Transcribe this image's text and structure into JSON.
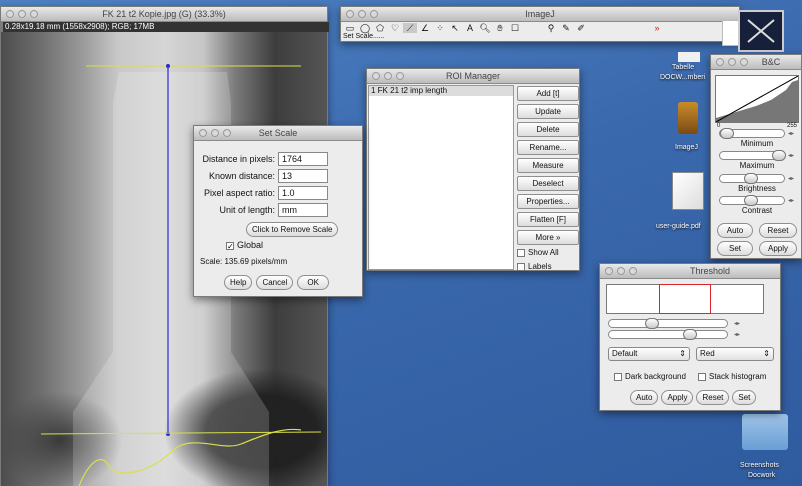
{
  "image_window": {
    "title": "FK 21 t2 Kopie.jpg (G) (33.3%)",
    "info": "0.28x19.18 mm (1558x2908); RGB; 17MB"
  },
  "imagej": {
    "title": "ImageJ",
    "status": "Set Scale......",
    "toolbar_icons": [
      "rectangle-tool",
      "oval-tool",
      "polygon-tool",
      "freehand-tool",
      "line-tool",
      "angle-tool",
      "point-tool",
      "wand-tool",
      "text-tool",
      "magnifier-tool",
      "hand-tool",
      "color-picker-tool",
      "dropper-tool",
      "pencil-tool",
      "brush-tool",
      "more-tools"
    ]
  },
  "roi_manager": {
    "title": "ROI Manager",
    "items": [
      "1 FK 21 t2 imp length"
    ],
    "buttons": [
      "Add [t]",
      "Update",
      "Delete",
      "Rename...",
      "Measure",
      "Deselect",
      "Properties...",
      "Flatten [F]",
      "More »"
    ],
    "show_all": "Show All",
    "labels": "Labels"
  },
  "set_scale": {
    "title": "Set Scale",
    "distance_label": "Distance in pixels:",
    "distance_value": "1764",
    "known_label": "Known distance:",
    "known_value": "13",
    "aspect_label": "Pixel aspect ratio:",
    "aspect_value": "1.0",
    "unit_label": "Unit of length:",
    "unit_value": "mm",
    "remove_button": "Click to Remove Scale",
    "global_label": "Global",
    "scale_text": "Scale: 135.69 pixels/mm",
    "help": "Help",
    "cancel": "Cancel",
    "ok": "OK"
  },
  "bc": {
    "title": "B&C",
    "min_tick": "0",
    "max_tick": "255",
    "minimum": "Minimum",
    "maximum": "Maximum",
    "brightness": "Brightness",
    "contrast": "Contrast",
    "auto": "Auto",
    "reset": "Reset",
    "set": "Set",
    "apply": "Apply"
  },
  "threshold": {
    "title": "Threshold",
    "method": "Default",
    "mode": "Red",
    "dark_bg": "Dark background",
    "stack_hist": "Stack histogram",
    "auto": "Auto",
    "apply": "Apply",
    "reset": "Reset",
    "set": "Set"
  },
  "desktop": {
    "tabelle": "Tabelle",
    "docw": "DOCW...mberi",
    "imagej_icon": "ImageJ",
    "user_guide": "user-guide.pdf",
    "screenshots": "Screenshots",
    "docwork": "Docwork"
  },
  "colors": {
    "desktop": "#3f6fb2",
    "threshold_red": "#d9252b",
    "scale_line_blue": "#2b2bd6",
    "roi_yellow": "#d8e04a"
  }
}
